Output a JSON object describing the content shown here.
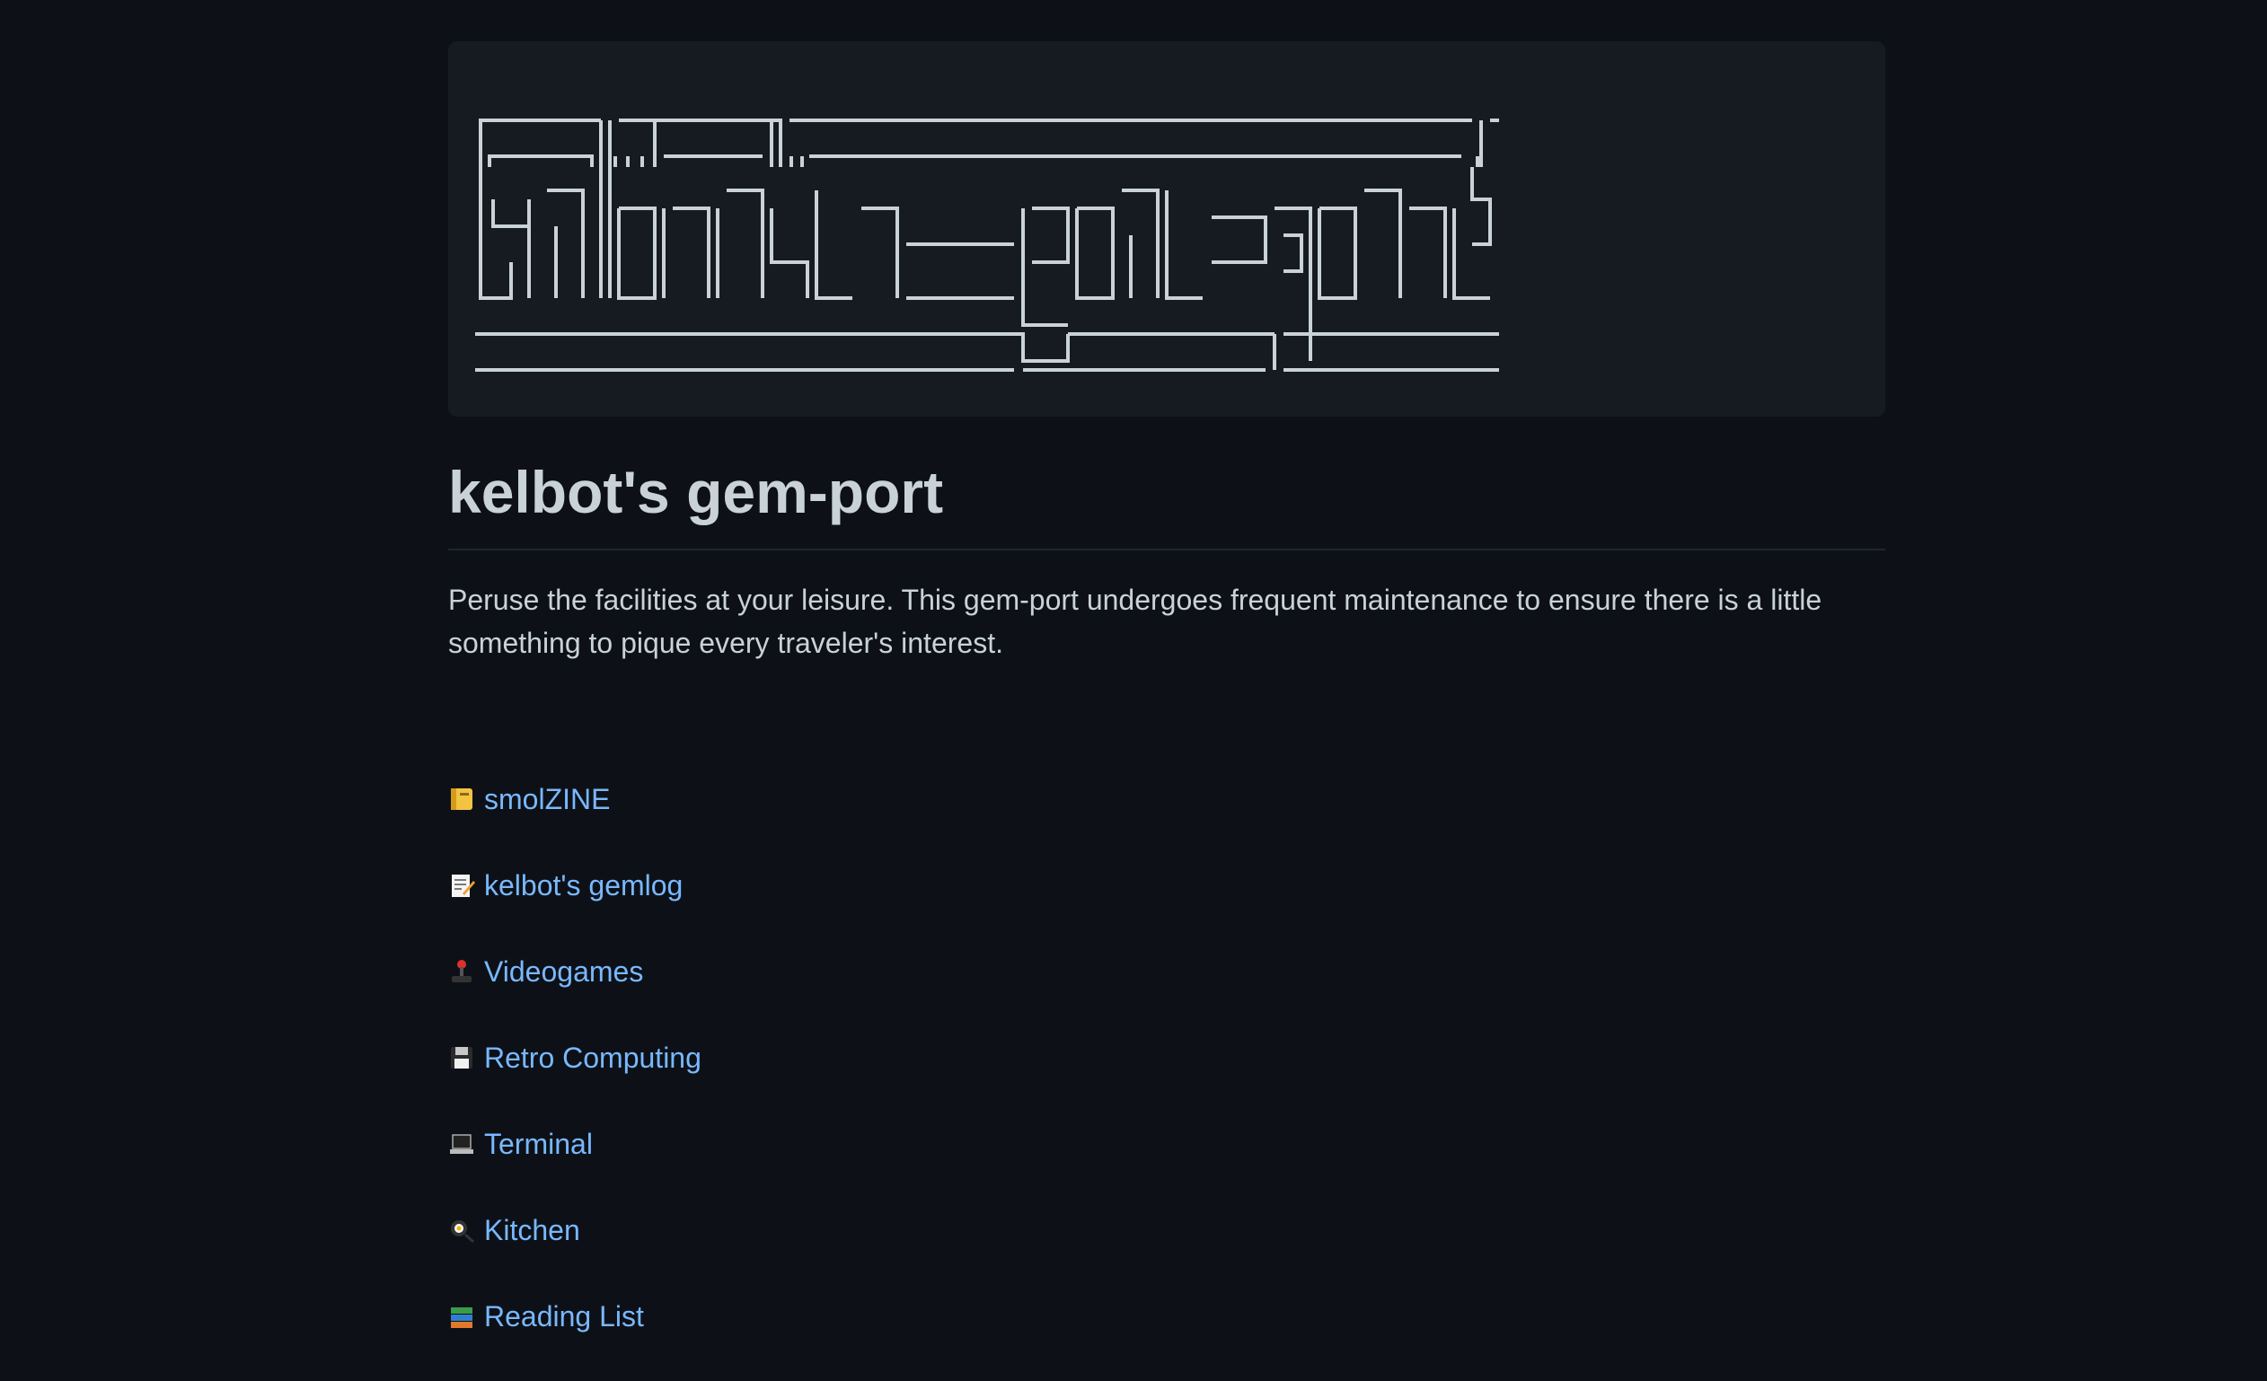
{
  "banner": {
    "alt": "kelbot's gem-port"
  },
  "page": {
    "title": "kelbot's gem-port",
    "intro": "Peruse the facilities at your leisure. This gem-port undergoes frequent maintenance to ensure there is a little something to pique every traveler's interest."
  },
  "links": [
    {
      "icon": "notebook-icon",
      "label": "smolZINE"
    },
    {
      "icon": "memo-icon",
      "label": "kelbot's gemlog"
    },
    {
      "icon": "joystick-icon",
      "label": "Videogames"
    },
    {
      "icon": "floppy-disk-icon",
      "label": "Retro Computing"
    },
    {
      "icon": "laptop-icon",
      "label": "Terminal"
    },
    {
      "icon": "frying-pan-icon",
      "label": "Kitchen"
    },
    {
      "icon": "books-icon",
      "label": "Reading List"
    }
  ],
  "colors": {
    "background": "#0d1117",
    "panel": "#161b22",
    "text": "#c9d1d9",
    "link": "#79b8ff"
  }
}
